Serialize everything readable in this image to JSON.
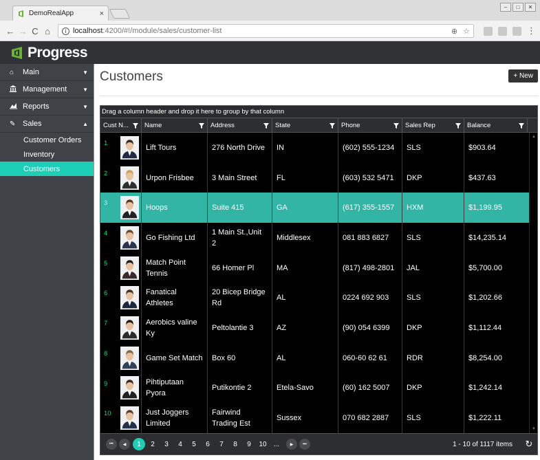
{
  "browser": {
    "tab_title": "DemoRealApp",
    "tab_close": "×",
    "url_host": "localhost",
    "url_path": ":4200/#!/module/sales/customer-list",
    "info_glyph": "i",
    "zoom_glyph": "⊕",
    "star_glyph": "☆",
    "menu_glyph": "⋮",
    "back_glyph": "←",
    "forward_glyph": "→",
    "reload_glyph": "C",
    "home_glyph": "⌂",
    "win_min": "–",
    "win_max": "□",
    "win_close": "✕"
  },
  "brand": {
    "name": "Progress"
  },
  "sidebar": {
    "caret_down": "▼",
    "caret_up": "▲",
    "sections": [
      {
        "label": "Main",
        "icon": "home-icon",
        "glyph": "⌂",
        "expanded": false
      },
      {
        "label": "Management",
        "icon": "bank-icon",
        "glyph": "🏛",
        "expanded": false
      },
      {
        "label": "Reports",
        "icon": "chart-icon",
        "glyph": "▲",
        "expanded": false
      },
      {
        "label": "Sales",
        "icon": "edit-icon",
        "glyph": "✎",
        "expanded": true
      }
    ],
    "sales_items": [
      {
        "label": "Customer Orders"
      },
      {
        "label": "Inventory"
      },
      {
        "label": "Customers",
        "active": true
      }
    ]
  },
  "page": {
    "title": "Customers",
    "new_button": "+ New"
  },
  "grid": {
    "group_hint": "Drag a column header and drop it here to group by that column",
    "columns": [
      "Cust N...",
      "Name",
      "Address",
      "State",
      "Phone",
      "Sales Rep",
      "Balance"
    ],
    "rows": [
      {
        "id": "1",
        "name": "Lift Tours",
        "address": "276 North Drive",
        "state": "IN",
        "phone": "(602) 555-1234",
        "rep": "SLS",
        "balance": "$903.64"
      },
      {
        "id": "2",
        "name": "Urpon Frisbee",
        "address": "3 Main Street",
        "state": "FL",
        "phone": "(603) 532 5471",
        "rep": "DKP",
        "balance": "$437.63"
      },
      {
        "id": "3",
        "name": "Hoops",
        "address": "Suite 415",
        "state": "GA",
        "phone": "(617) 355-1557",
        "rep": "HXM",
        "balance": "$1,199.95",
        "selected": true
      },
      {
        "id": "4",
        "name": "Go Fishing Ltd",
        "address": "1 Main St.,Unit 2",
        "state": "Middlesex",
        "phone": "081 883 6827",
        "rep": "SLS",
        "balance": "$14,235.14"
      },
      {
        "id": "5",
        "name": "Match Point Tennis",
        "address": "66 Homer Pl",
        "state": "MA",
        "phone": "(817) 498-2801",
        "rep": "JAL",
        "balance": "$5,700.00"
      },
      {
        "id": "6",
        "name": "Fanatical Athletes",
        "address": "20 Bicep Bridge Rd",
        "state": "AL",
        "phone": "0224 692 903",
        "rep": "SLS",
        "balance": "$1,202.66"
      },
      {
        "id": "7",
        "name": "Aerobics valine Ky",
        "address": "Peltolantie 3",
        "state": "AZ",
        "phone": "(90) 054 6399",
        "rep": "DKP",
        "balance": "$1,112.44"
      },
      {
        "id": "8",
        "name": "Game Set Match",
        "address": "Box 60",
        "state": "AL",
        "phone": "060-60 62 61",
        "rep": "RDR",
        "balance": "$8,254.00"
      },
      {
        "id": "9",
        "name": "Pihtiputaan Pyora",
        "address": "Putikontie 2",
        "state": "Etela-Savo",
        "phone": "(60) 162 5007",
        "rep": "DKP",
        "balance": "$1,242.14"
      },
      {
        "id": "10",
        "name": "Just Joggers Limited",
        "address": "Fairwind Trading Est",
        "state": "Sussex",
        "phone": "070 682 2887",
        "rep": "SLS",
        "balance": "$1,222.11"
      }
    ]
  },
  "pager": {
    "first_glyph": "⏮",
    "prev_glyph": "◀",
    "next_glyph": "▶",
    "last_glyph": "⏭",
    "pages": [
      "1",
      "2",
      "3",
      "4",
      "5",
      "6",
      "7",
      "8",
      "9",
      "10",
      "..."
    ],
    "current_page": "1",
    "info": "1 - 10 of 1117 items",
    "refresh_glyph": "↻"
  },
  "colors": {
    "accent": "#1ecfb8",
    "selected_row": "#33b5a6",
    "brand_orange": "#67b531",
    "id_text": "#00e070"
  }
}
